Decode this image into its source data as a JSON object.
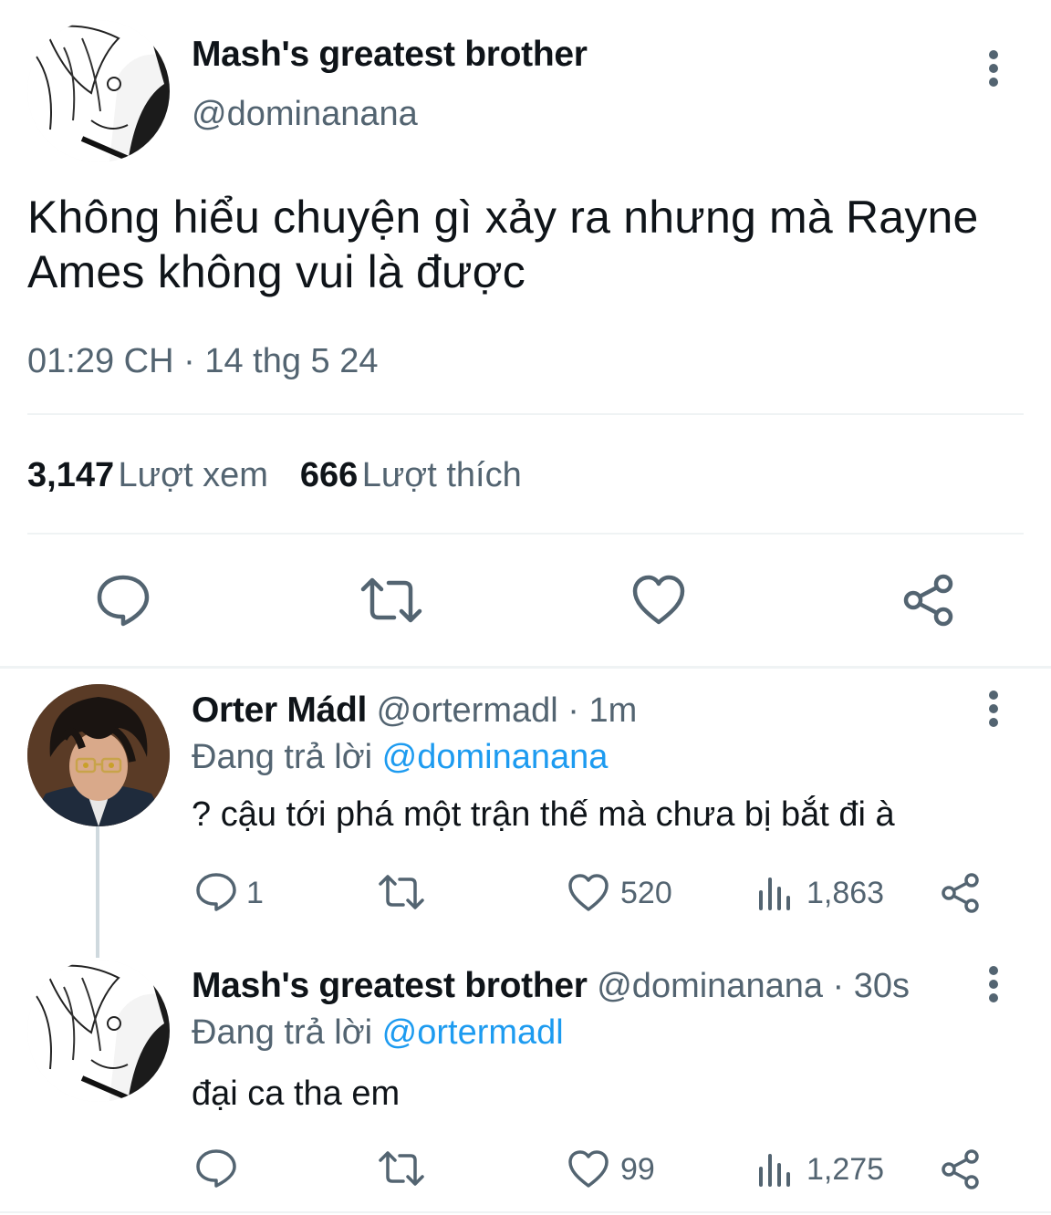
{
  "main_tweet": {
    "author_name": "Mash's greatest brother",
    "author_handle": "@dominanana",
    "text": "Không hiểu chuyện gì xảy ra nhưng mà Rayne Ames không vui là được",
    "time": "01:29 CH",
    "separator": "·",
    "date": "14 thg 5 24",
    "views_count": "3,147",
    "views_label": "Lượt xem",
    "likes_count": "666",
    "likes_label": "Lượt thích"
  },
  "replies": [
    {
      "author_name": "Orter Mádl",
      "author_handle": "@ortermadl",
      "age": "· 1m",
      "replying_prefix": "Đang trả lời",
      "replying_to": "@dominanana",
      "text": "? cậu tới phá một trận thế mà chưa bị bắt đi à",
      "reply_count": "1",
      "retweet_count": "",
      "like_count": "520",
      "view_count": "1,863"
    },
    {
      "author_name": "Mash's greatest brother",
      "author_handle": "@dominanana",
      "age": "· 30s",
      "replying_prefix": "Đang trả lời",
      "replying_to": "@ortermadl",
      "text": "đại ca tha em",
      "reply_count": "",
      "retweet_count": "",
      "like_count": "99",
      "view_count": "1,275"
    }
  ],
  "icons": {
    "reply": "reply-icon",
    "retweet": "retweet-icon",
    "like": "heart-icon",
    "share": "share-icon",
    "views": "views-icon",
    "more": "more-options-icon"
  },
  "colors": {
    "text": "#0f1419",
    "secondary": "#536471",
    "link": "#1d9bf0",
    "divider": "#eff3f4"
  }
}
